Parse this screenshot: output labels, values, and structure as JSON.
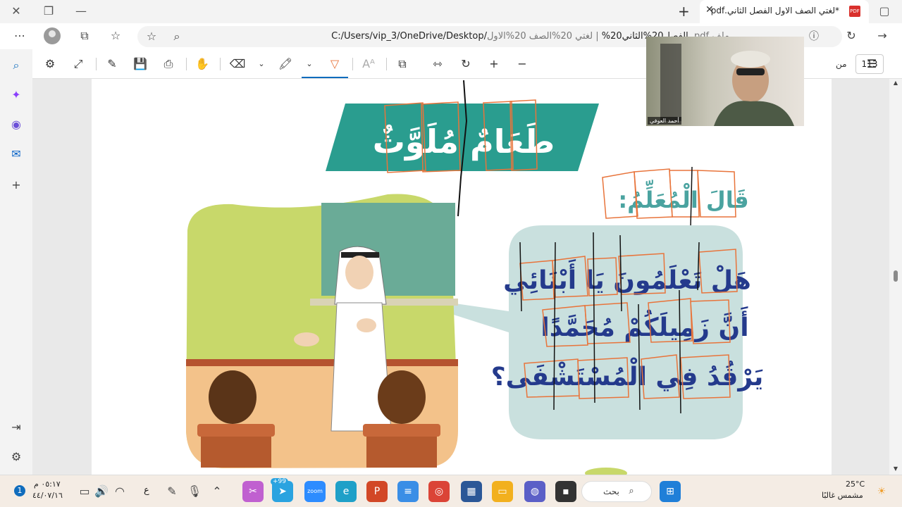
{
  "browser": {
    "tab_title": "*لغتي الصف الاول الفصل الثاني.pdf",
    "pdf_badge": "PDF",
    "new_tab_icon": "plus-icon",
    "address_prefix": "ملف",
    "address_mid": "| لغتي 20%الصف 20%الاول .pdf",
    "address_path": "C:/Users/vip_3/OneDrive/Desktop/الفصل20%الثاني20%"
  },
  "pdf_toolbar": {
    "page_number": "113",
    "page_of_label": "من"
  },
  "slide": {
    "title": "طَعَامٌ مُلَوَّثٌ",
    "speaker_label": "قَالَ الْمُعَلِّمُ:",
    "bubble_lines": [
      "هَلْ تَعْلَمُونَ يَا أَبْنَائِي",
      "أَنَّ زَمِيلَكُمْ مُحَمَّدًا",
      "يَرْقُدُ فِي الْمُسْتَشْفَى؟"
    ]
  },
  "webcam": {
    "name_tag": "أحمد العوفي"
  },
  "taskbar": {
    "search_label": "بحث",
    "time": "٠٥:١٧ م",
    "date": "٤٤/٠٧/١٦",
    "weather_temp": "25°C",
    "weather_desc": "مشمس غالبًا",
    "lang_indicator": "ع",
    "notification_count": "1",
    "telegram_badge": "+99"
  },
  "colors": {
    "title_banner": "#2a9d8f",
    "bubble": "#c9e0de",
    "bubble_text": "#243a8c",
    "annotation_orange": "#e8743b",
    "speaker_text": "#4aa3a0"
  }
}
